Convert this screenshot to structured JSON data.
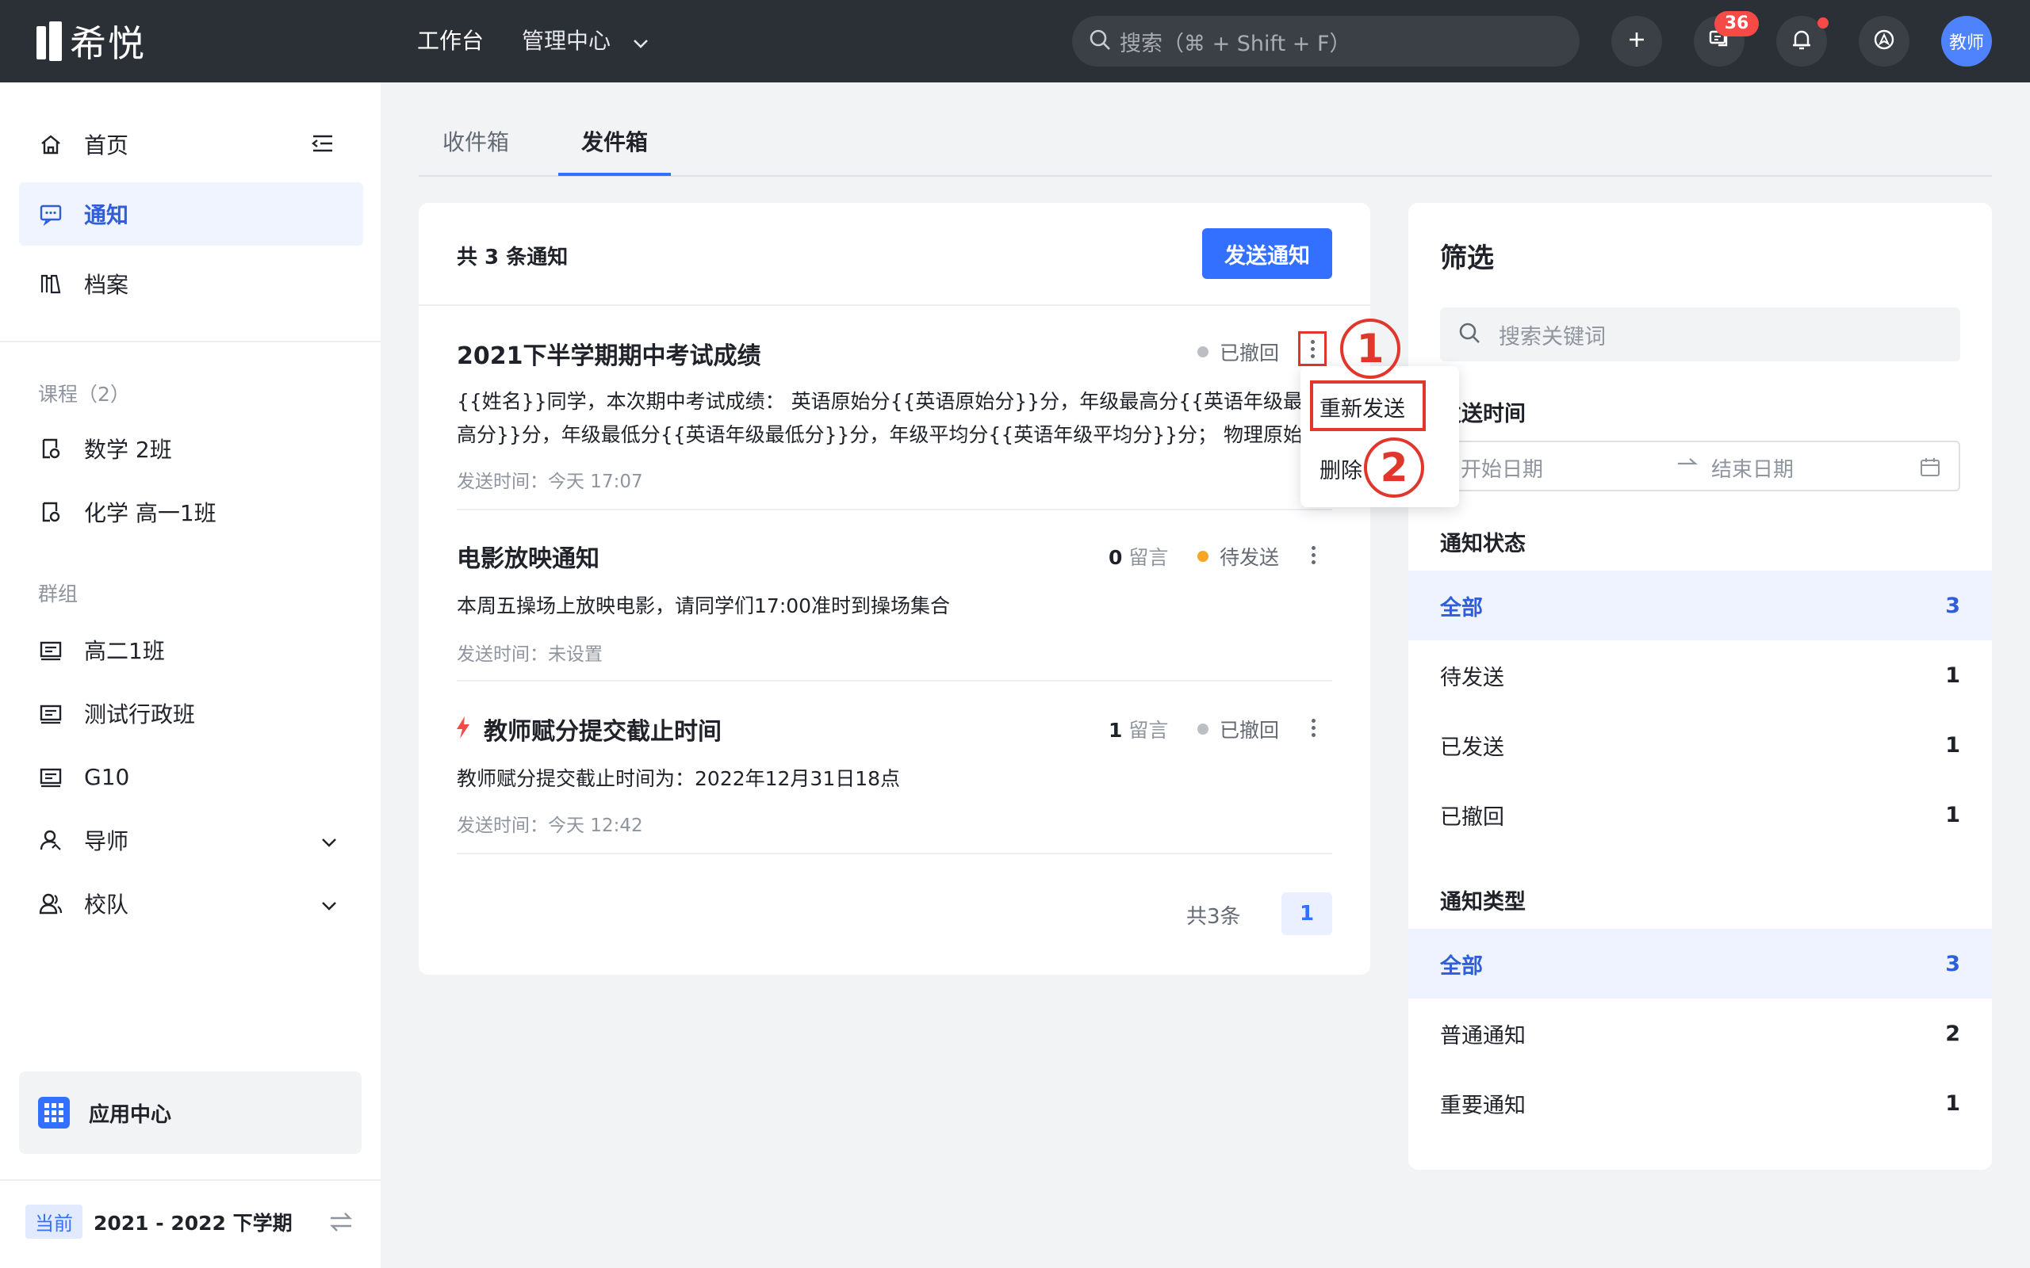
{
  "app": {
    "name": "希悦"
  },
  "topnav": {
    "workbench": "工作台",
    "management": "管理中心"
  },
  "search": {
    "placeholder": "搜索（⌘ + Shift + F）"
  },
  "header": {
    "message_count": "36",
    "avatar_label": "教师"
  },
  "sidebar": {
    "home": "首页",
    "notice": "通知",
    "archive": "档案",
    "courses_heading": "课程（2）",
    "courses": [
      "数学 2班",
      "化学 高一1班"
    ],
    "groups_heading": "群组",
    "groups": [
      "高二1班",
      "测试行政班",
      "G10"
    ],
    "mentor": "导师",
    "team": "校队",
    "app_center": "应用中心",
    "term_tag": "当前",
    "term": "2021 - 2022 下学期"
  },
  "tabs": {
    "inbox": "收件箱",
    "outbox": "发件箱"
  },
  "list": {
    "total": "共 3 条通知",
    "send_button": "发送通知",
    "comments_suffix": "留言",
    "items": [
      {
        "title": "2021下半学期期中考试成绩",
        "body": "{{姓名}}同学，本次期中考试成绩： 英语原始分{{英语原始分}}分，年级最高分{{英语年级最高分}}分，年级最低分{{英语年级最低分}}分，年级平均分{{英语年级平均分}}分； 物理原始分{{物理...",
        "time": "发送时间：今天 17:07",
        "status": "已撤回",
        "status_color": "#bbbfc4"
      },
      {
        "title": "电影放映通知",
        "body": "本周五操场上放映电影，请同学们17:00准时到操场集合",
        "time": "发送时间：未设置",
        "status": "待发送",
        "status_color": "#f5a623",
        "comments": "0"
      },
      {
        "title": "教师赋分提交截止时间",
        "body": "教师赋分提交截止时间为：2022年12月31日18点",
        "time": "发送时间：今天 12:42",
        "status": "已撤回",
        "status_color": "#bbbfc4",
        "comments": "1",
        "important": true
      }
    ],
    "pagination_total": "共3条",
    "current_page": "1"
  },
  "dropdown": {
    "resend": "重新发送",
    "delete": "删除"
  },
  "annotations": {
    "step1": "1",
    "step2": "2"
  },
  "filter": {
    "title": "筛选",
    "search_placeholder": "搜索关键词",
    "send_time_label": "发送时间",
    "start_date": "开始日期",
    "end_date": "结束日期",
    "status_label": "通知状态",
    "status_options": [
      {
        "label": "全部",
        "count": "3"
      },
      {
        "label": "待发送",
        "count": "1"
      },
      {
        "label": "已发送",
        "count": "1"
      },
      {
        "label": "已撤回",
        "count": "1"
      }
    ],
    "type_label": "通知类型",
    "type_options": [
      {
        "label": "全部",
        "count": "3"
      },
      {
        "label": "普通通知",
        "count": "2"
      },
      {
        "label": "重要通知",
        "count": "1"
      }
    ]
  },
  "colors": {
    "primary": "#3370ff",
    "topbar": "#2b2f36",
    "annotation": "#e0362c"
  }
}
